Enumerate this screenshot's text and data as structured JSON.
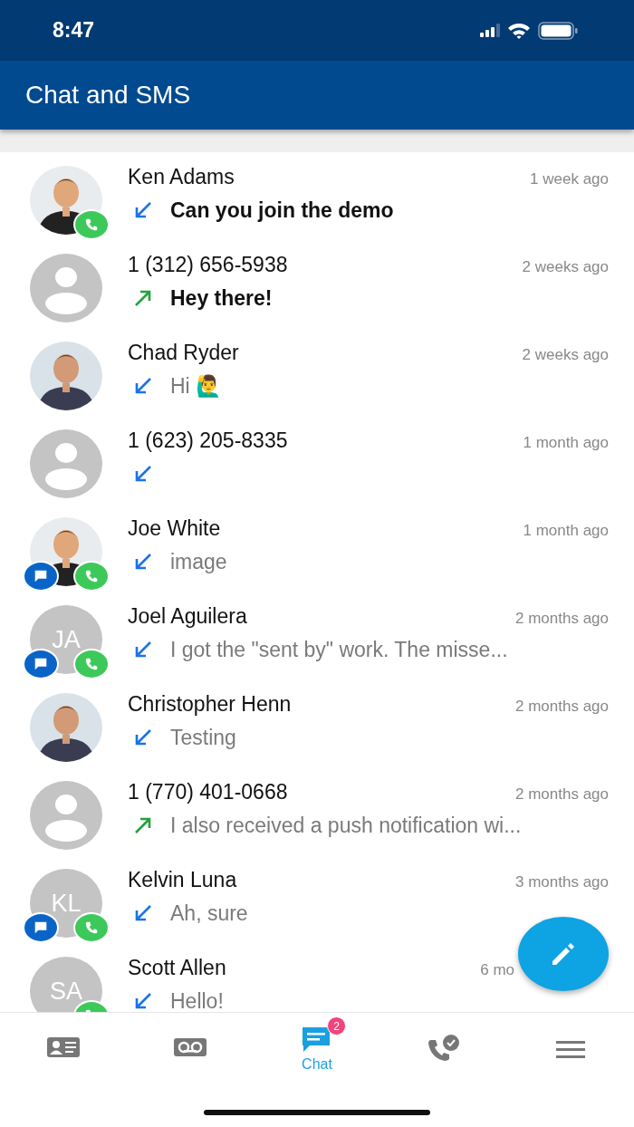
{
  "status_bar": {
    "time": "8:47"
  },
  "header": {
    "title": "Chat and SMS"
  },
  "conversations": [
    {
      "name": "Ken Adams",
      "time": "1 week ago",
      "kind": "incoming",
      "message": "Can you join the demo",
      "unread": true,
      "chat_badge": false,
      "phone_badge": true
    },
    {
      "name": "1 (312) 656-5938",
      "time": "2 weeks ago",
      "kind": "outgoing",
      "message": "Hey there!",
      "unread": true,
      "avatar": {
        "kind": "placeholder"
      },
      "chat_badge": false,
      "phone_badge": false
    },
    {
      "name": "Chad Ryder",
      "time": "2 weeks ago",
      "kind": "incoming",
      "message": "Hi 🙋‍♂️",
      "unread": false,
      "chat_badge": false,
      "phone_badge": false
    },
    {
      "name": "1 (623) 205-8335",
      "time": "1 month ago",
      "kind": "incoming",
      "avatar": {
        "kind": "placeholder"
      },
      "chat_badge": false,
      "phone_badge": false
    },
    {
      "name": "Joe White",
      "time": "1 month ago",
      "kind": "incoming",
      "message": "image",
      "unread": false,
      "chat_badge": true,
      "phone_badge": true
    },
    {
      "name": "Joel Aguilera",
      "time": "2 months ago",
      "kind": "incoming",
      "message": "I got the \"sent by\" work. The misse...",
      "unread": false,
      "avatar": {
        "kind": "initials",
        "initials": "JA"
      },
      "chat_badge": true,
      "phone_badge": true
    },
    {
      "name": "Christopher Henn",
      "time": "2 months ago",
      "kind": "incoming",
      "message": "Testing",
      "unread": false,
      "chat_badge": false,
      "phone_badge": false
    },
    {
      "name": "1 (770) 401-0668",
      "time": "2 months ago",
      "kind": "outgoing",
      "message": "I also received a push notification wi...",
      "unread": false,
      "avatar": {
        "kind": "placeholder"
      },
      "chat_badge": false,
      "phone_badge": false
    },
    {
      "name": "Kelvin Luna",
      "time": "3 months ago",
      "kind": "incoming",
      "message": "Ah, sure",
      "unread": false,
      "avatar": {
        "kind": "initials",
        "initials": "KL"
      },
      "chat_badge": true,
      "phone_badge": true
    },
    {
      "name": "Scott Allen",
      "time": "6 mo",
      "kind": "incoming",
      "message": "Hello!",
      "unread": false,
      "avatar": {
        "kind": "initials",
        "initials": "SA"
      },
      "chat_badge": false,
      "phone_badge": true
    }
  ],
  "tabs": [
    {
      "kind": "contacts",
      "selected": false
    },
    {
      "kind": "voicemail",
      "selected": false
    },
    {
      "kind": "chat",
      "label": "Chat",
      "badge": "2",
      "selected": true
    },
    {
      "kind": "recent-calls",
      "selected": false
    },
    {
      "kind": "menu",
      "selected": false
    }
  ]
}
